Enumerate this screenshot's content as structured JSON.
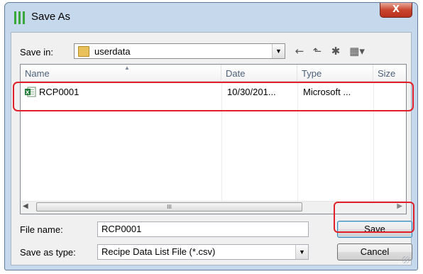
{
  "dialog": {
    "title": "Save As",
    "close_glyph": "X"
  },
  "savein": {
    "label": "Save in:",
    "value": "userdata",
    "folder_icon": "folder-icon",
    "arrow": "▼"
  },
  "toolbar": {
    "back": "←",
    "up": "⬑",
    "new_folder": "✱",
    "view_menu": "▦▾"
  },
  "filelist": {
    "columns": [
      "Name",
      "Date",
      "Type",
      "Size"
    ],
    "sort_glyph": "▲",
    "rows": [
      {
        "name": "RCP0001",
        "date": "10/30/201...",
        "type": "Microsoft ...",
        "size": "",
        "icon": "excel-csv-icon"
      }
    ],
    "scroll_left": "◀",
    "scroll_right": "▶",
    "scroll_grip": "III"
  },
  "form": {
    "filename_label": "File name:",
    "filename_value": "RCP0001",
    "type_label": "Save as type:",
    "type_value": "Recipe Data List File (*.csv)",
    "type_arrow": "▼"
  },
  "buttons": {
    "save": "Save",
    "cancel": "Cancel"
  },
  "colors": {
    "highlight": "#e0212a",
    "window_frame": "#c6d9ec",
    "close_button": "#c9452f"
  }
}
